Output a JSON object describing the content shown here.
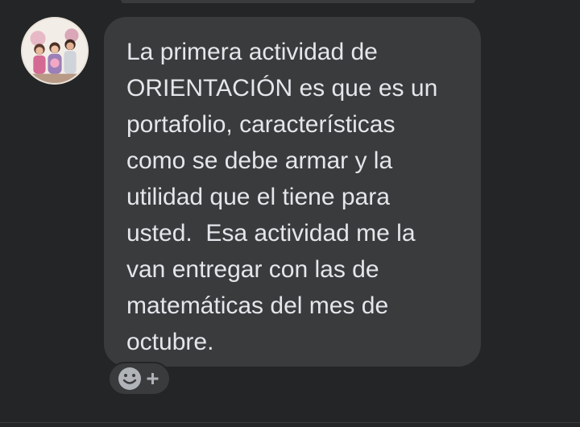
{
  "message": {
    "text": "La primera actividad de\nORIENTACIÓN es que es un\nportafolio, características\ncomo se debe armar y la\nutilidad que el tiene para\nusted.  Esa actividad me la\nvan entregar con las de\nmatemáticas del mes de\noctubre."
  },
  "avatar": {
    "icon": "user-avatar-photo"
  },
  "reaction": {
    "icon": "add-reaction-smiley-plus-icon"
  },
  "colors": {
    "background": "#242526",
    "bubble": "#3a3b3c",
    "text": "#e4e6eb"
  }
}
